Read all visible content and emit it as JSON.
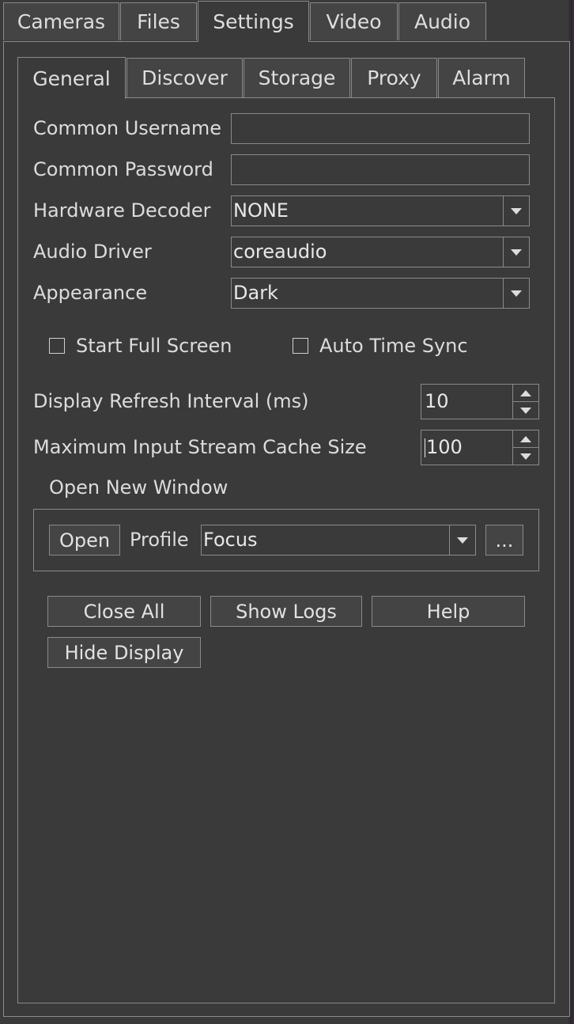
{
  "top_tabs": [
    {
      "label": "Cameras",
      "active": false
    },
    {
      "label": "Files",
      "active": false
    },
    {
      "label": "Settings",
      "active": true
    },
    {
      "label": "Video",
      "active": false
    },
    {
      "label": "Audio",
      "active": false
    }
  ],
  "sub_tabs": [
    {
      "label": "General",
      "active": true
    },
    {
      "label": "Discover",
      "active": false
    },
    {
      "label": "Storage",
      "active": false
    },
    {
      "label": "Proxy",
      "active": false
    },
    {
      "label": "Alarm",
      "active": false
    }
  ],
  "general": {
    "common_username": {
      "label": "Common Username",
      "value": ""
    },
    "common_password": {
      "label": "Common Password",
      "value": ""
    },
    "hardware_decoder": {
      "label": "Hardware Decoder",
      "value": "NONE"
    },
    "audio_driver": {
      "label": "Audio Driver",
      "value": "coreaudio"
    },
    "appearance": {
      "label": "Appearance",
      "value": "Dark"
    },
    "start_full_screen": {
      "label": "Start Full Screen",
      "checked": false
    },
    "auto_time_sync": {
      "label": "Auto Time Sync",
      "checked": false
    },
    "display_refresh_interval": {
      "label": "Display Refresh Interval (ms)",
      "value": "10"
    },
    "max_input_stream_cache": {
      "label": "Maximum Input Stream Cache Size",
      "value": "100"
    },
    "open_new_window": {
      "title": "Open New Window",
      "open_label": "Open",
      "profile_label": "Profile",
      "profile_value": "Focus",
      "more_label": "..."
    },
    "buttons": {
      "close_all": "Close All",
      "show_logs": "Show Logs",
      "help": "Help",
      "hide_display": "Hide Display"
    }
  },
  "colors": {
    "background": "#3a3a3a",
    "border": "#8a8a8a",
    "text": "#dcdcdc"
  }
}
